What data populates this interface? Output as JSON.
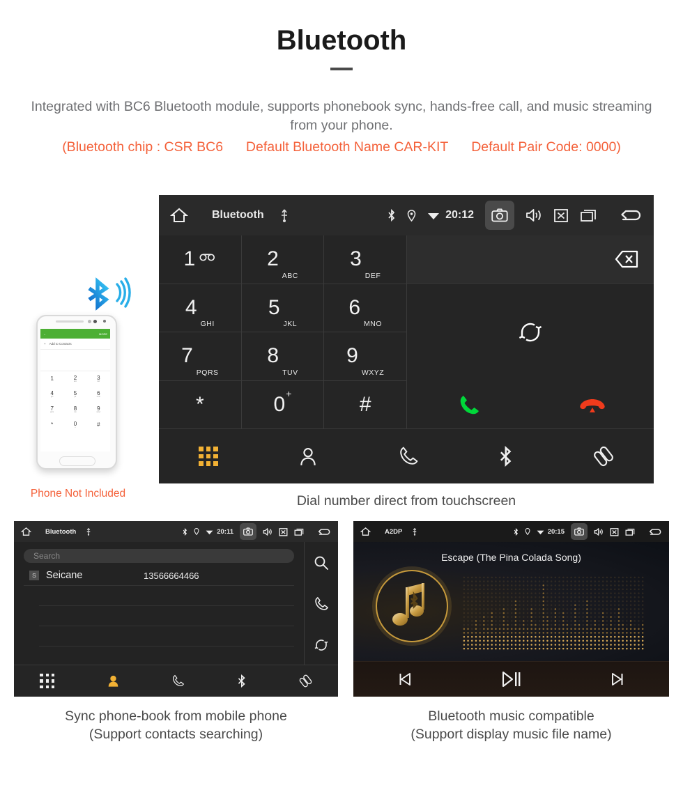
{
  "header": {
    "title": "Bluetooth",
    "description": "Integrated with BC6 Bluetooth module, supports phonebook sync, hands-free call, and music streaming from your phone.",
    "spec_chip": "(Bluetooth chip : CSR BC6",
    "spec_name": "Default Bluetooth Name CAR-KIT",
    "spec_pair": "Default Pair Code: 0000)",
    "accent_color": "#f4613a",
    "body_color": "#6f7073"
  },
  "dialer": {
    "statusbar": {
      "title": "Bluetooth",
      "time": "20:12",
      "icons": [
        "home-icon",
        "usb-icon",
        "bluetooth-icon",
        "location-icon",
        "wifi-icon",
        "camera-icon",
        "volume-icon",
        "close-box-icon",
        "recents-icon",
        "back-icon"
      ]
    },
    "keys": [
      {
        "num": "1",
        "sub": "",
        "vm": true
      },
      {
        "num": "2",
        "sub": "ABC"
      },
      {
        "num": "3",
        "sub": "DEF"
      },
      {
        "num": "4",
        "sub": "GHI"
      },
      {
        "num": "5",
        "sub": "JKL"
      },
      {
        "num": "6",
        "sub": "MNO"
      },
      {
        "num": "7",
        "sub": "PQRS"
      },
      {
        "num": "8",
        "sub": "TUV"
      },
      {
        "num": "9",
        "sub": "WXYZ"
      },
      {
        "num": "*",
        "sub": ""
      },
      {
        "num": "0",
        "sub": "",
        "plus": "+"
      },
      {
        "num": "#",
        "sub": ""
      }
    ],
    "actions": {
      "backspace": "backspace-icon",
      "sync": "sync-icon",
      "call": "call-icon",
      "end_call": "end-call-icon",
      "call_color": "#00d83a",
      "end_color": "#ef3b1c"
    },
    "navbar": [
      {
        "icon": "keypad-icon",
        "active": true
      },
      {
        "icon": "contacts-icon",
        "active": false
      },
      {
        "icon": "call-log-icon",
        "active": false
      },
      {
        "icon": "bluetooth-icon",
        "active": false
      },
      {
        "icon": "link-icon",
        "active": false
      }
    ],
    "active_color": "#f2b134",
    "caption": "Dial number direct from touchscreen"
  },
  "phone_mockup": {
    "appbar_back": "back-arrow-icon",
    "appbar_more": "MORE",
    "add_contacts": "Add to Contacts",
    "keys": [
      {
        "num": "1",
        "sub": ""
      },
      {
        "num": "2",
        "sub": "abc"
      },
      {
        "num": "3",
        "sub": "def"
      },
      {
        "num": "4",
        "sub": "ghi"
      },
      {
        "num": "5",
        "sub": "jkl"
      },
      {
        "num": "6",
        "sub": "mno"
      },
      {
        "num": "7",
        "sub": "pqrs"
      },
      {
        "num": "8",
        "sub": "tuv"
      },
      {
        "num": "9",
        "sub": "wxyz"
      },
      {
        "num": "*",
        "sub": ""
      },
      {
        "num": "0",
        "sub": "+"
      },
      {
        "num": "#",
        "sub": ""
      }
    ],
    "note": "Phone Not Included",
    "note_color": "#f4613a",
    "bluetooth_logo_color": "#1f9fe8"
  },
  "phonebook": {
    "statusbar": {
      "title": "Bluetooth",
      "time": "20:11"
    },
    "search_placeholder": "Search",
    "contacts": [
      {
        "badge": "S",
        "name": "Seicane",
        "number": "13566664466"
      }
    ],
    "sidebar": [
      "search-icon",
      "call-icon",
      "sync-icon"
    ],
    "navbar": [
      {
        "icon": "keypad-icon",
        "active": false
      },
      {
        "icon": "contacts-icon",
        "active": true
      },
      {
        "icon": "call-log-icon",
        "active": false
      },
      {
        "icon": "bluetooth-icon",
        "active": false
      },
      {
        "icon": "link-icon",
        "active": false
      }
    ],
    "caption_line1": "Sync phone-book from mobile phone",
    "caption_line2": "(Support contacts searching)"
  },
  "music": {
    "statusbar": {
      "title": "A2DP",
      "time": "20:15"
    },
    "song_title": "Escape (The Pina Colada Song)",
    "logo": "music-note-bluetooth-icon",
    "controls": [
      "previous-track-icon",
      "play-pause-icon",
      "next-track-icon"
    ],
    "accent_color": "#c89b3c",
    "caption_line1": "Bluetooth music compatible",
    "caption_line2": "(Support display music file name)"
  }
}
